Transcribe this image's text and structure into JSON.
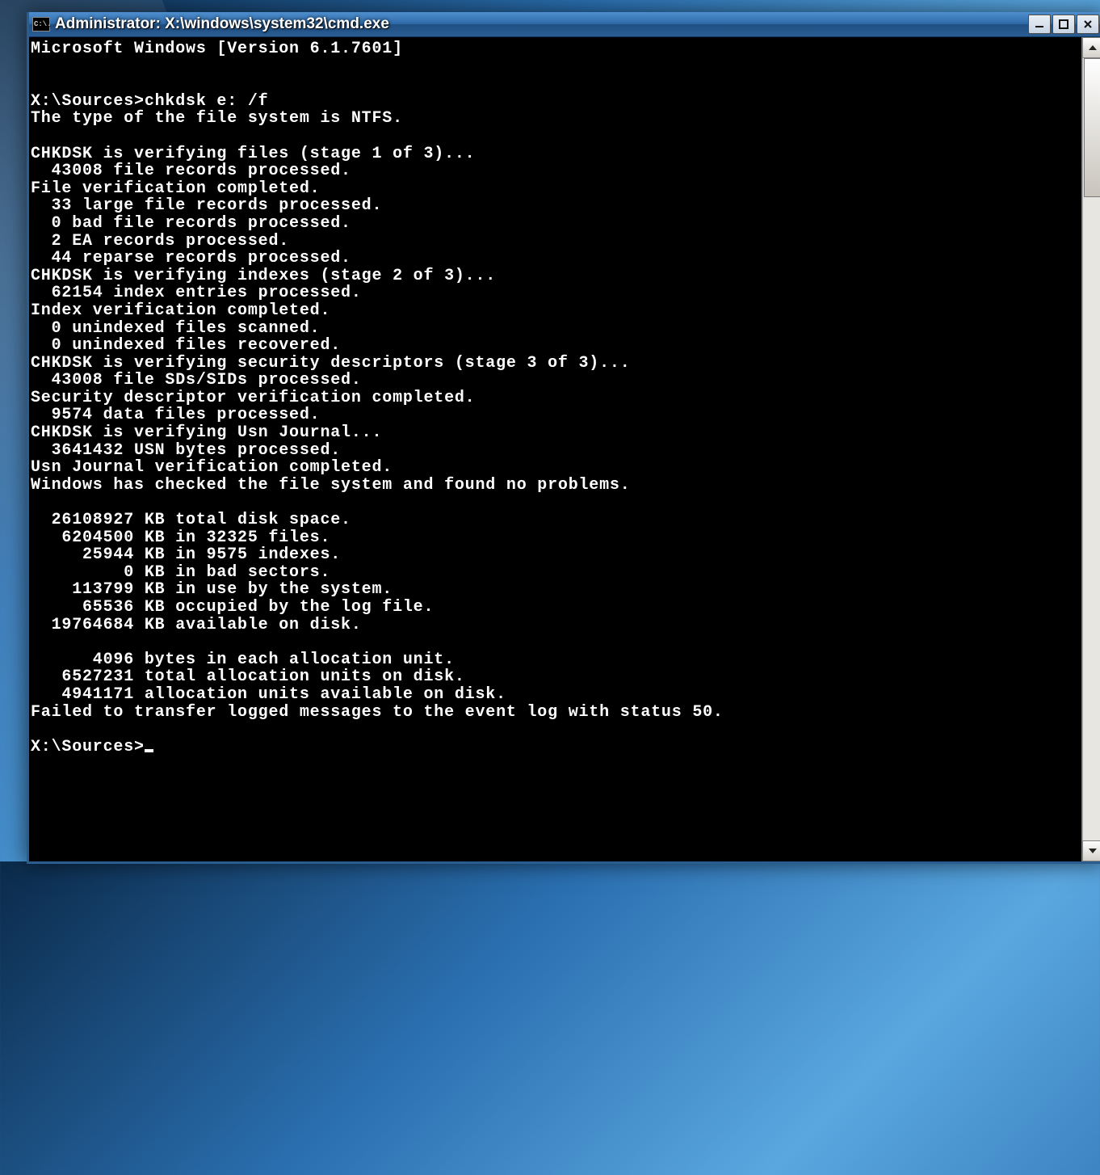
{
  "titlebar": {
    "icon_label": "C:\\.",
    "title": "Administrator: X:\\windows\\system32\\cmd.exe"
  },
  "console": {
    "lines": [
      "Microsoft Windows [Version 6.1.7601]",
      "",
      "",
      "X:\\Sources>chkdsk e: /f",
      "The type of the file system is NTFS.",
      "",
      "CHKDSK is verifying files (stage 1 of 3)...",
      "  43008 file records processed.",
      "File verification completed.",
      "  33 large file records processed.",
      "  0 bad file records processed.",
      "  2 EA records processed.",
      "  44 reparse records processed.",
      "CHKDSK is verifying indexes (stage 2 of 3)...",
      "  62154 index entries processed.",
      "Index verification completed.",
      "  0 unindexed files scanned.",
      "  0 unindexed files recovered.",
      "CHKDSK is verifying security descriptors (stage 3 of 3)...",
      "  43008 file SDs/SIDs processed.",
      "Security descriptor verification completed.",
      "  9574 data files processed.",
      "CHKDSK is verifying Usn Journal...",
      "  3641432 USN bytes processed.",
      "Usn Journal verification completed.",
      "Windows has checked the file system and found no problems.",
      "",
      "  26108927 KB total disk space.",
      "   6204500 KB in 32325 files.",
      "     25944 KB in 9575 indexes.",
      "         0 KB in bad sectors.",
      "    113799 KB in use by the system.",
      "     65536 KB occupied by the log file.",
      "  19764684 KB available on disk.",
      "",
      "      4096 bytes in each allocation unit.",
      "   6527231 total allocation units on disk.",
      "   4941171 allocation units available on disk.",
      "Failed to transfer logged messages to the event log with status 50.",
      ""
    ],
    "prompt": "X:\\Sources>"
  }
}
